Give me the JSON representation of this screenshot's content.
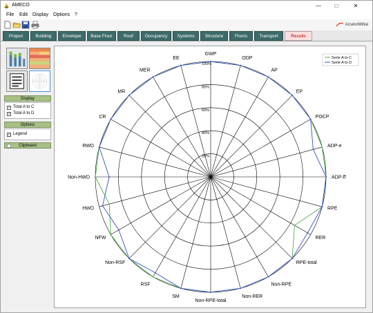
{
  "window": {
    "title": "AMECO"
  },
  "menu": [
    "File",
    "Edit",
    "Display",
    "Options",
    "?"
  ],
  "brand": "ArcelorMittal",
  "tabs": [
    "Project",
    "Building",
    "Envelope",
    "Base Floor",
    "Roof",
    "Occupancy",
    "Systems",
    "Structure",
    "Floors",
    "Transport",
    "Results"
  ],
  "active_tab": "Results",
  "sidebar": {
    "display": {
      "header": "Display",
      "items": [
        {
          "label": "Total A to C",
          "checked": true
        },
        {
          "label": "Total A to D",
          "checked": true
        }
      ]
    },
    "options": {
      "header": "Options",
      "items": [
        {
          "label": "Legend",
          "checked": true
        }
      ]
    },
    "clipboard": {
      "header": "Clipboard"
    }
  },
  "chart_data": {
    "type": "radar",
    "axes": [
      "GWP",
      "ODP",
      "AP",
      "EP",
      "POCP",
      "ADP-e",
      "ADP-ff",
      "RPE",
      "RER",
      "RPE-total",
      "Non-RPE",
      "Non-RER",
      "Non-RPE-total",
      "SM",
      "RSF",
      "Non-RSF",
      "NFW",
      "HWD",
      "Non-HWD",
      "RWD",
      "CR",
      "MR",
      "MER",
      "EE"
    ],
    "ring_labels": [
      "20%",
      "40%",
      "60%",
      "80%",
      "100%"
    ],
    "range": [
      0,
      100
    ],
    "legend_position": "top-right",
    "series": [
      {
        "name": "Serie A to C",
        "color": "#4caf50",
        "values": [
          100,
          100,
          100,
          100,
          100,
          100,
          100,
          100,
          84,
          100,
          100,
          100,
          100,
          100,
          100,
          100,
          100,
          91,
          100,
          100,
          100,
          100,
          100,
          100
        ]
      },
      {
        "name": "Serie A to D",
        "color": "#3a4fc8",
        "values": [
          100,
          100,
          100,
          100,
          100,
          92,
          100,
          100,
          97,
          100,
          100,
          100,
          100,
          100,
          96,
          100,
          92,
          97,
          88,
          100,
          100,
          100,
          100,
          100
        ]
      }
    ]
  }
}
